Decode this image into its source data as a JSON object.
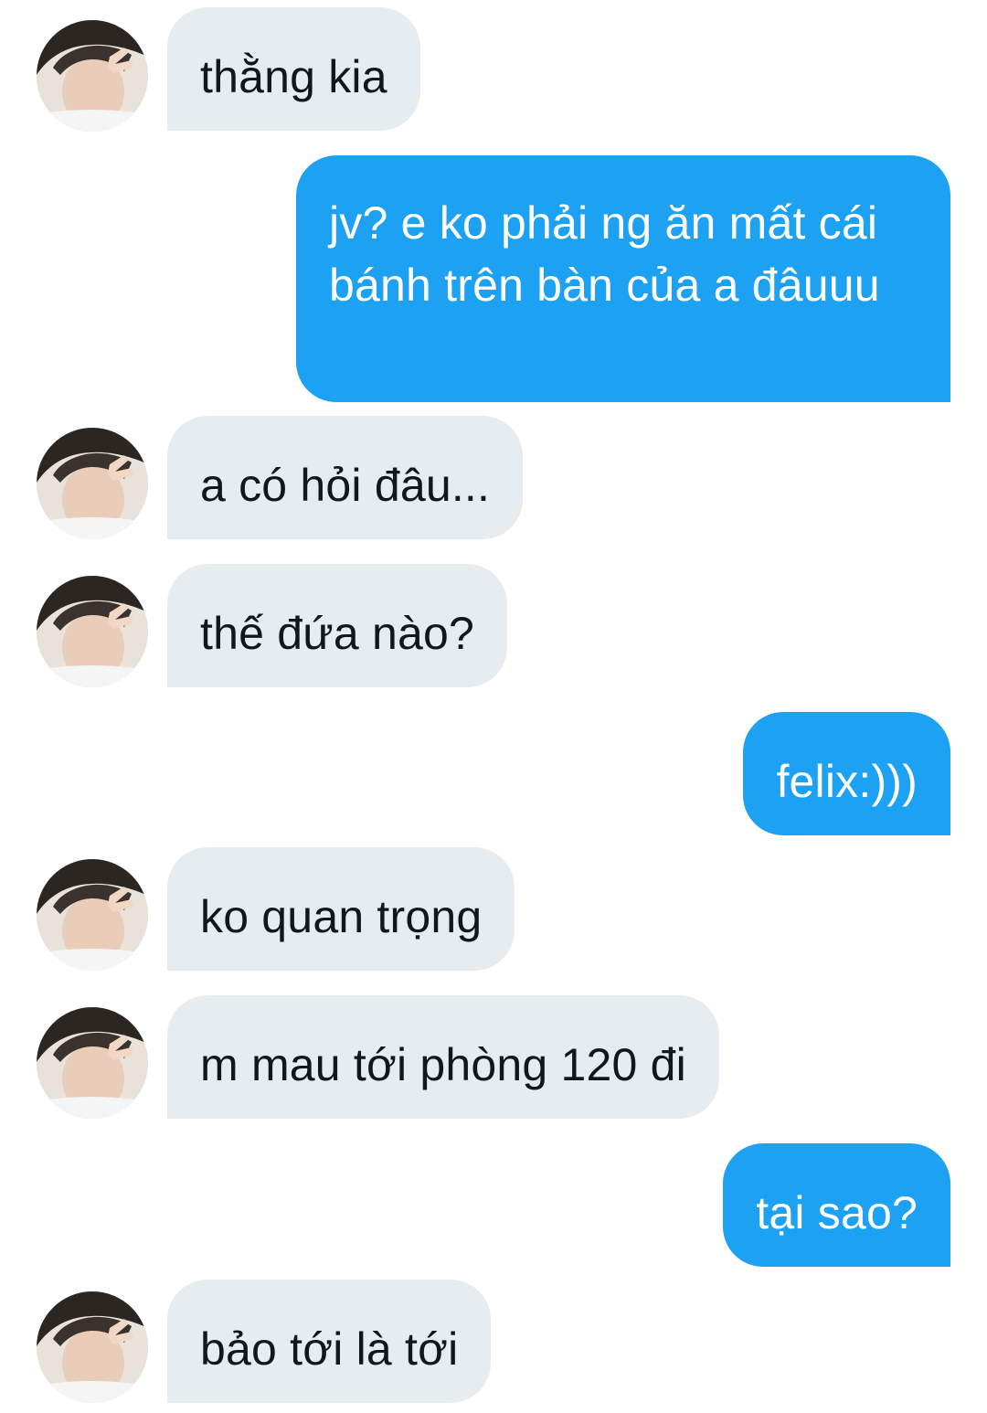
{
  "colors": {
    "incoming_bubble": "#e6ecf0",
    "outgoing_bubble": "#1da1f2",
    "incoming_text": "#14171a",
    "outgoing_text": "#ffffff"
  },
  "messages": [
    {
      "side": "incoming",
      "text": "thằng kia",
      "avatar": "user-avatar"
    },
    {
      "side": "outgoing",
      "text": "jv? e ko phải ng ăn mất cái bánh trên bàn của a đâuuu"
    },
    {
      "side": "incoming",
      "text": "a có hỏi đâu...",
      "avatar": "user-avatar"
    },
    {
      "side": "incoming",
      "text": "thế đứa nào?",
      "avatar": "user-avatar"
    },
    {
      "side": "outgoing",
      "text": "felix:)))"
    },
    {
      "side": "incoming",
      "text": "ko quan trọng",
      "avatar": "user-avatar"
    },
    {
      "side": "incoming",
      "text": "m mau tới phòng 120 đi",
      "avatar": "user-avatar"
    },
    {
      "side": "outgoing",
      "text": "tại sao?"
    },
    {
      "side": "incoming",
      "text": "bảo tới là tới",
      "avatar": "user-avatar"
    }
  ]
}
